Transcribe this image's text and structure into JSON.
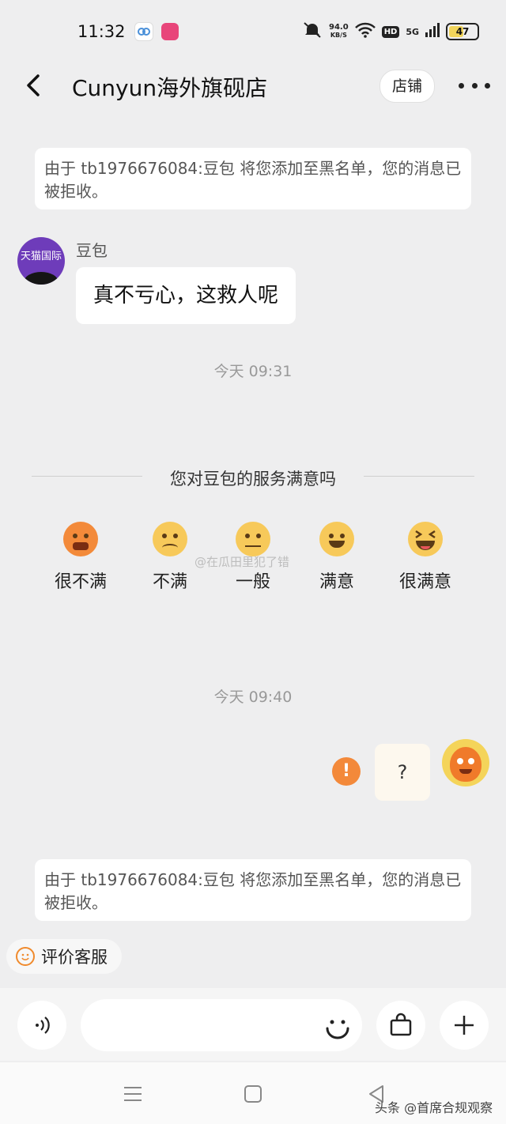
{
  "status_bar": {
    "time": "11:32",
    "net_speed_value": "94.0",
    "net_speed_unit": "KB/S",
    "hd": "HD",
    "network": "5G",
    "battery": "47"
  },
  "header": {
    "title": "Cunyun海外旗砚店",
    "shop_button": "店铺"
  },
  "messages": {
    "notice_1": "由于 tb1976676084:豆包 将您添加至黑名单，您的消息已被拒收。",
    "avatar_text": "天猫国际",
    "sender_name": "豆包",
    "incoming_text": "真不亏心，这救人呢",
    "timestamp_1": "今天  09:31",
    "timestamp_2": "今天  09:40",
    "outgoing_text": "?",
    "notice_2": "由于 tb1976676084:豆包 将您添加至黑名单，您的消息已被拒收。"
  },
  "survey": {
    "title": "您对豆包的服务满意吗",
    "options": [
      {
        "label": "很不满",
        "color": "#f38a3a"
      },
      {
        "label": "不满",
        "color": "#f7c95a"
      },
      {
        "label": "一般",
        "color": "#f7c95a"
      },
      {
        "label": "满意",
        "color": "#f7c95a"
      },
      {
        "label": "很满意",
        "color": "#f7c95a"
      }
    ]
  },
  "watermark": "@在瓜田里犯了错",
  "rate_service": "评价客服",
  "footer_credit": "头条 @首席合规观察",
  "colors": {
    "background": "#eeeeef",
    "accent_orange": "#f3893a",
    "avatar_purple": "#6e3cba"
  }
}
